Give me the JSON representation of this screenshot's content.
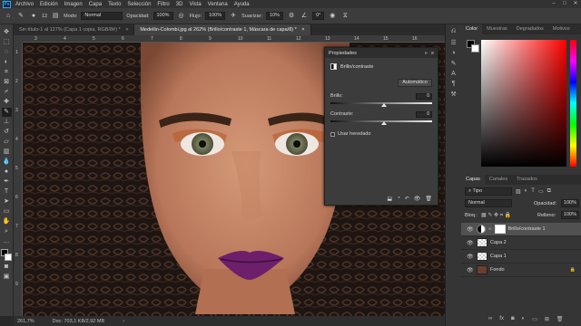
{
  "app": {
    "logo_text": "Ps"
  },
  "menu": [
    "Archivo",
    "Edición",
    "Imagen",
    "Capa",
    "Texto",
    "Selección",
    "Filtro",
    "3D",
    "Vista",
    "Ventana",
    "Ayuda"
  ],
  "window_controls": [
    "–",
    "□",
    "✕"
  ],
  "options_bar": {
    "mode_label": "Modo:",
    "mode_value": "Normal",
    "opacity_label": "Opacidad:",
    "opacity_value": "100%",
    "flow_label": "Flujo:",
    "flow_value": "100%",
    "smooth_label": "Suavizar:",
    "smooth_value": "10%",
    "angle_value": "0°",
    "brush_size": "12"
  },
  "tabs": [
    {
      "label": "Sin título-1 al 127% (Capa 1 copia, RGB/8#) *",
      "close": "×"
    },
    {
      "label": "Medellin-Colombi.jpg al 262% (Brillo/contraste 1, Máscara de capa/8) *",
      "close": "×"
    }
  ],
  "ruler": {
    "h": [
      "3",
      "4",
      "5",
      "6",
      "7",
      "8",
      "9",
      "10",
      "11",
      "12",
      "13",
      "14",
      "15",
      "16"
    ],
    "v": [
      "1",
      "2",
      "3",
      "4",
      "5",
      "6",
      "7",
      "8",
      "9"
    ]
  },
  "status": {
    "zoom": "261,7%",
    "doc": "Doc: 703,1 KB/2,92 MB",
    "arrow": "›"
  },
  "properties": {
    "title": "Propiedades",
    "layer_label": "Brillo/contraste",
    "auto_button": "Automático",
    "brightness_label": "Brillo:",
    "brightness_value": "0",
    "contrast_label": "Contraste:",
    "contrast_value": "0",
    "legacy_label": "Usar heredado",
    "expand": "»",
    "menu": "≡"
  },
  "color_panel": {
    "tabs": [
      "Color",
      "Muestras",
      "Degradados",
      "Motivos"
    ],
    "hue_fraction": 0.0
  },
  "layers_panel": {
    "tabs": [
      "Capas",
      "Canales",
      "Trazados"
    ],
    "filter_label": "Tipo",
    "blend_mode": "Normal",
    "opacity_label": "Opacidad:",
    "opacity_value": "100%",
    "lock_label": "Bloq.:",
    "fill_label": "Relleno:",
    "fill_value": "100%",
    "layers": [
      {
        "name": "Brillo/contraste 1",
        "selected": true
      },
      {
        "name": "Capa 2",
        "selected": false
      },
      {
        "name": "Capa 1",
        "selected": false
      },
      {
        "name": "Fondo",
        "selected": false,
        "lock": "🔒"
      }
    ],
    "footer_icons": [
      "link-icon",
      "fx-icon",
      "mask-icon",
      "adjustment-icon",
      "folder-icon",
      "new-layer-icon",
      "trash-icon"
    ]
  },
  "colors": {
    "accent": "#31a8ff",
    "panel": "#3c3c3c",
    "dark": "#282828",
    "lip": "#6e1f6b"
  }
}
